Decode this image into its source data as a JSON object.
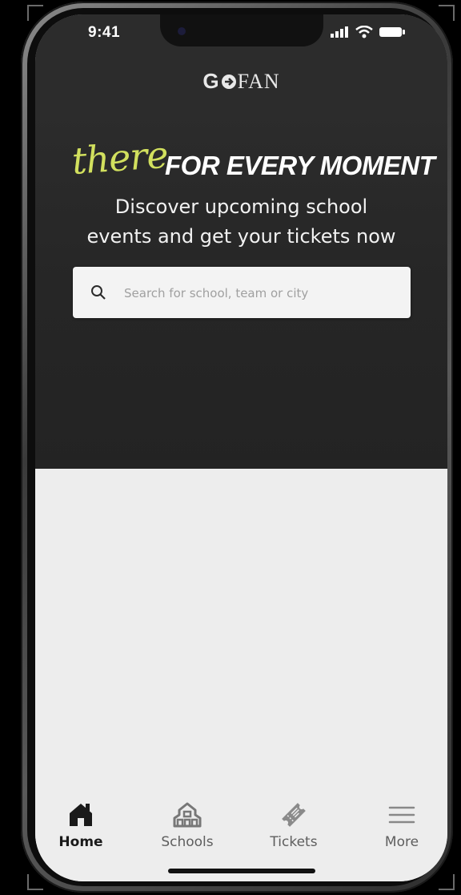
{
  "status_bar": {
    "time": "9:41"
  },
  "brand": {
    "logo_go": "G",
    "logo_o_icon": "arrow-o-icon",
    "logo_fan": "FAN"
  },
  "hero": {
    "tagline_script": "there",
    "tagline_bold": "FOR EVERY MOMENT",
    "subtitle_line1": "Discover upcoming school",
    "subtitle_line2": "events and get your tickets now"
  },
  "search": {
    "placeholder": "Search for school, team or city",
    "value": ""
  },
  "tab_bar": {
    "tabs": [
      {
        "label": "Home",
        "icon": "house-icon",
        "active": true
      },
      {
        "label": "Schools",
        "icon": "school-building-icon",
        "active": false
      },
      {
        "label": "Tickets",
        "icon": "ticket-icon",
        "active": false
      },
      {
        "label": "More",
        "icon": "hamburger-menu-icon",
        "active": false
      }
    ]
  },
  "colors": {
    "hero_background": "#2a2a2a",
    "accent_script": "#d2e05e",
    "page_background": "#ededed",
    "active_tab": "#1a1a1a",
    "inactive_tab": "#5e5e5e"
  }
}
